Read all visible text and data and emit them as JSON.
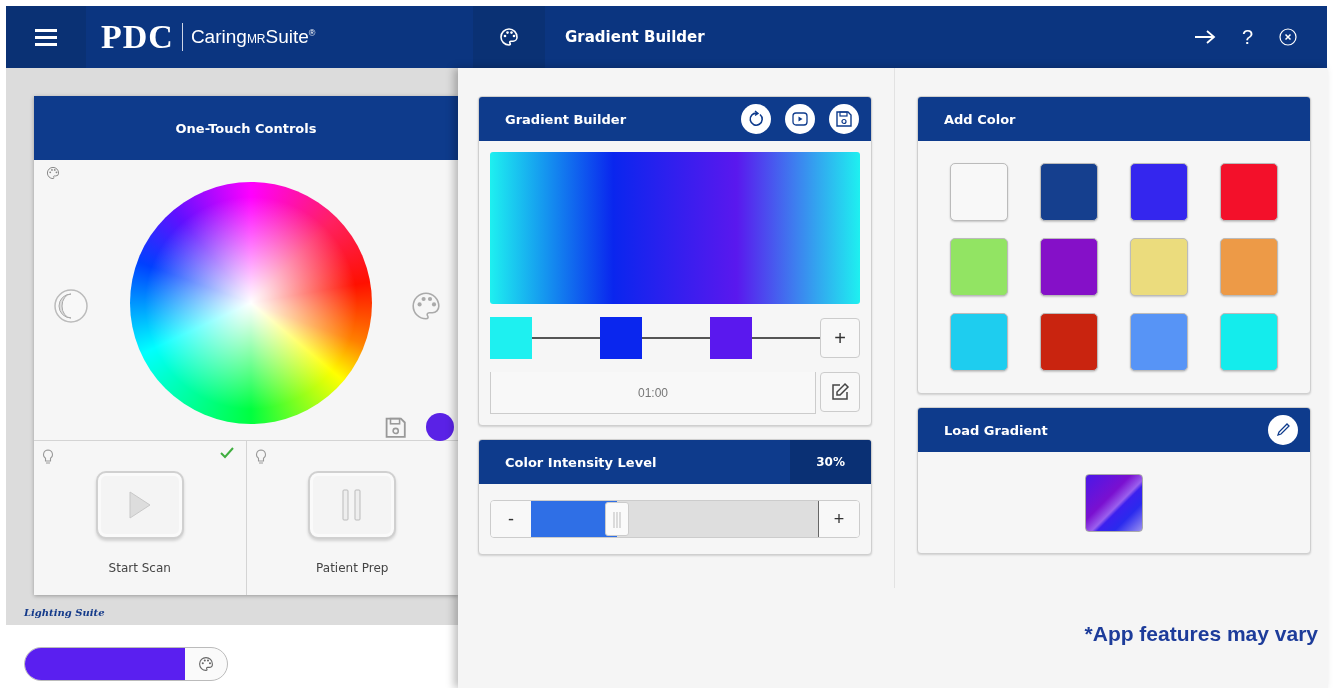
{
  "header": {
    "logo": {
      "mark": "PDC",
      "product": "Caring",
      "product_mid": "MR",
      "product_end": "Suite$^{®}$"
    },
    "title": "Gradient Builder",
    "help": "?"
  },
  "one_touch": {
    "title": "One-Touch Controls",
    "current": {
      "color": "#5a22e6"
    },
    "tiles": [
      {
        "label": "Start Scan",
        "kind": "play",
        "checked": true
      },
      {
        "label": "Patient Prep",
        "kind": "pause",
        "checked": false
      }
    ]
  },
  "lighting_suite": {
    "title": "Lighting Suite",
    "color": "#5a1ff0"
  },
  "gradient_builder": {
    "title": "Gradient Builder",
    "stops": [
      {
        "color": "#1ef0f0"
      },
      {
        "color": "#0a26ee"
      },
      {
        "color": "#5a18ee"
      }
    ],
    "add": "+",
    "duration": "01:00"
  },
  "intensity": {
    "title": "Color Intensity Level",
    "reading": "30%",
    "level": 0.3,
    "decrease": "-",
    "increase": "+"
  },
  "add_color": {
    "title": "Add Color",
    "swatches": [
      {
        "color": "#f8f8f8"
      },
      {
        "color": "#153f8e"
      },
      {
        "color": "#3426ee"
      },
      {
        "color": "#f3102a"
      },
      {
        "color": "#92e463"
      },
      {
        "color": "#8510c8"
      },
      {
        "color": "#ebdc7d"
      },
      {
        "color": "#ed9a47"
      },
      {
        "color": "#1ecdef"
      },
      {
        "color": "#c9240f"
      },
      {
        "color": "#5794f6"
      },
      {
        "color": "#14ecec"
      }
    ]
  },
  "load_gradient": {
    "title": "Load Gradient"
  },
  "footnote": "*App features may vary"
}
